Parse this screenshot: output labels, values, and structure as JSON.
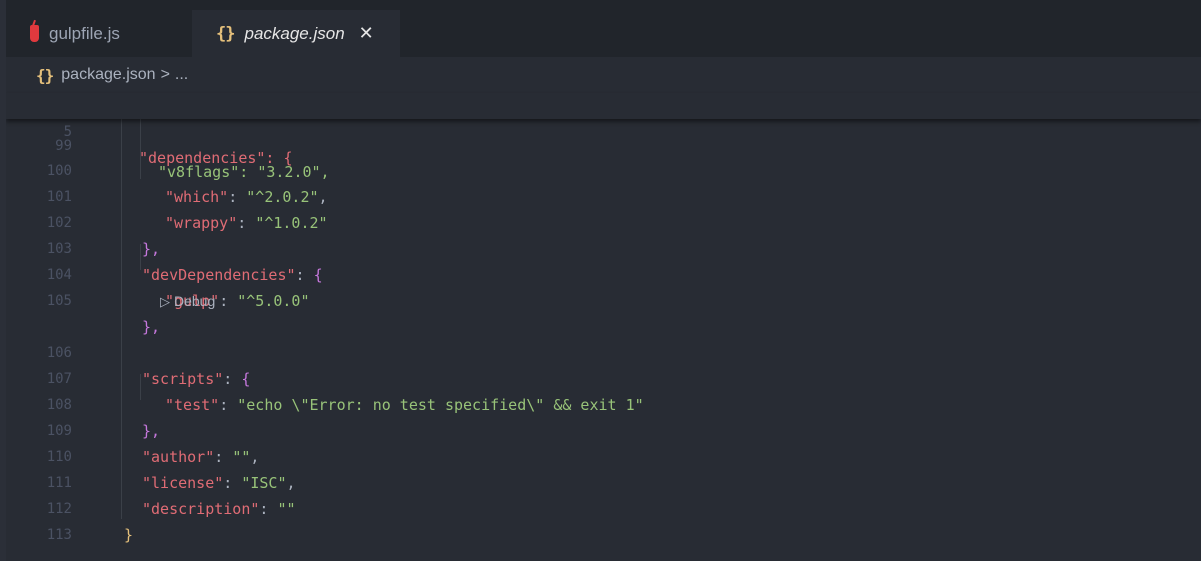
{
  "tabs": [
    {
      "label": "gulpfile.js",
      "icon": "gulp-icon",
      "active": false
    },
    {
      "label": "package.json",
      "icon": "braces-icon",
      "active": true,
      "close": "✕"
    }
  ],
  "breadcrumb": {
    "icon": "{}",
    "file": "package.json",
    "sep": ">",
    "more": "..."
  },
  "sticky_line": {
    "num": "5",
    "text": "\"dependencies\": {"
  },
  "peek_line": {
    "num": "99",
    "text": "\"v8flags\": \"3.2.0\","
  },
  "lines": [
    {
      "num": "100",
      "key": "\"which\"",
      "colon": ": ",
      "val": "\"^2.0.2\"",
      "tail": ","
    },
    {
      "num": "101",
      "key": "\"wrappy\"",
      "colon": ": ",
      "val": "\"^1.0.2\"",
      "tail": ""
    },
    {
      "num": "102",
      "close": "},"
    },
    {
      "num": "103",
      "key": "\"devDependencies\"",
      "colon": ": ",
      "open": "{"
    },
    {
      "num": "104",
      "key": "\"gulp\"",
      "colon": ": ",
      "val": "\"^5.0.0\"",
      "tail": ""
    },
    {
      "num": "105",
      "close": "},"
    },
    {
      "num": "106",
      "key": "\"scripts\"",
      "colon": ": ",
      "open": "{"
    },
    {
      "num": "107",
      "key": "\"test\"",
      "colon": ": ",
      "val": "\"echo \\\"Error: no test specified\\\" && exit 1\"",
      "tail": ""
    },
    {
      "num": "108",
      "close": "},"
    },
    {
      "num": "109",
      "key": "\"author\"",
      "colon": ": ",
      "val": "\"\"",
      "tail": ","
    },
    {
      "num": "110",
      "key": "\"license\"",
      "colon": ": ",
      "val": "\"ISC\"",
      "tail": ","
    },
    {
      "num": "111",
      "key": "\"description\"",
      "colon": ": ",
      "val": "\"\"",
      "tail": ""
    },
    {
      "num": "112",
      "close": "}"
    },
    {
      "num": "113"
    }
  ],
  "codelens": {
    "icon": "play-icon",
    "label": "Debug"
  },
  "colors": {
    "key": "#e06c75",
    "string": "#98c379",
    "brace": "#c678dd",
    "outer_brace": "#e5c07b",
    "background": "#282c34"
  }
}
